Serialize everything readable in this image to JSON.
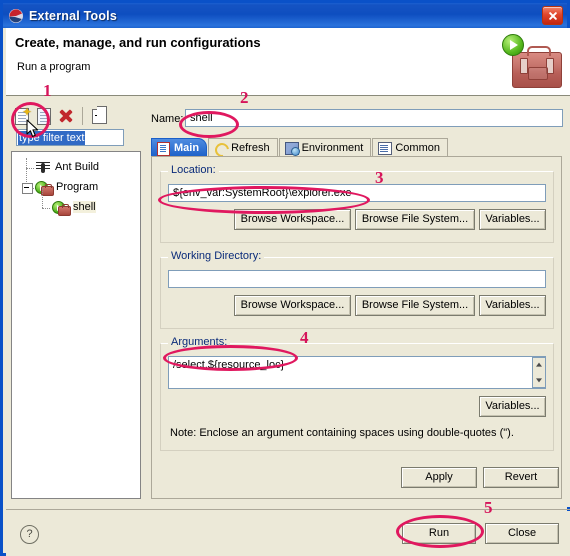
{
  "window": {
    "title": "External Tools",
    "title_icon": "eclipse-icon",
    "close_label": "close-icon"
  },
  "header": {
    "title": "Create, manage, and run configurations",
    "subtitle": "Run a program",
    "art_icon": "toolbox-with-run-badge"
  },
  "left_panel": {
    "toolbar": [
      {
        "name": "new-launch-configuration",
        "icon": "new-doc-sparkle-icon"
      },
      {
        "name": "duplicate-launch-configuration",
        "icon": "duplicate-doc-icon"
      },
      {
        "name": "delete-launch-configuration",
        "icon": "red-x-delete-icon"
      },
      {
        "name": "collapse-all",
        "icon": "collapse-all-icon"
      }
    ],
    "filter": {
      "value": "type filter text",
      "placeholder": "type filter text",
      "selected": true
    },
    "tree": [
      {
        "label": "Ant Build",
        "icon": "ant-icon",
        "indent": 1,
        "expander": false,
        "selected": false
      },
      {
        "label": "Program",
        "icon": "program-icon",
        "indent": 0,
        "expander": true,
        "selected": false
      },
      {
        "label": "shell",
        "icon": "program-icon",
        "indent": 2,
        "expander": false,
        "selected": true
      }
    ]
  },
  "right_panel": {
    "name_label": "Name:",
    "name_value": "shell",
    "tabs": [
      {
        "label": "Main",
        "icon": "main-doc-icon",
        "active": true
      },
      {
        "label": "Refresh",
        "icon": "refresh-icon",
        "active": false
      },
      {
        "label": "Environment",
        "icon": "environment-icon",
        "active": false
      },
      {
        "label": "Common",
        "icon": "common-icon",
        "active": false
      }
    ],
    "location": {
      "label": "Location:",
      "value": "${env_var:SystemRoot}\\explorer.exe",
      "buttons": [
        "Browse Workspace...",
        "Browse File System...",
        "Variables..."
      ]
    },
    "working_directory": {
      "label": "Working Directory:",
      "value": "",
      "buttons": [
        "Browse Workspace...",
        "Browse File System...",
        "Variables..."
      ]
    },
    "arguments": {
      "label": "Arguments:",
      "value": "/select,${resource_loc}",
      "buttons": [
        "Variables..."
      ],
      "note": "Note: Enclose an argument containing spaces using double-quotes (\")."
    },
    "apply_label": "Apply",
    "revert_label": "Revert"
  },
  "footer": {
    "help_icon": "?",
    "run_label": "Run",
    "close_label": "Close"
  },
  "annotations": {
    "color": "#e0185f",
    "numbers": [
      "1",
      "2",
      "3",
      "4",
      "5"
    ]
  }
}
